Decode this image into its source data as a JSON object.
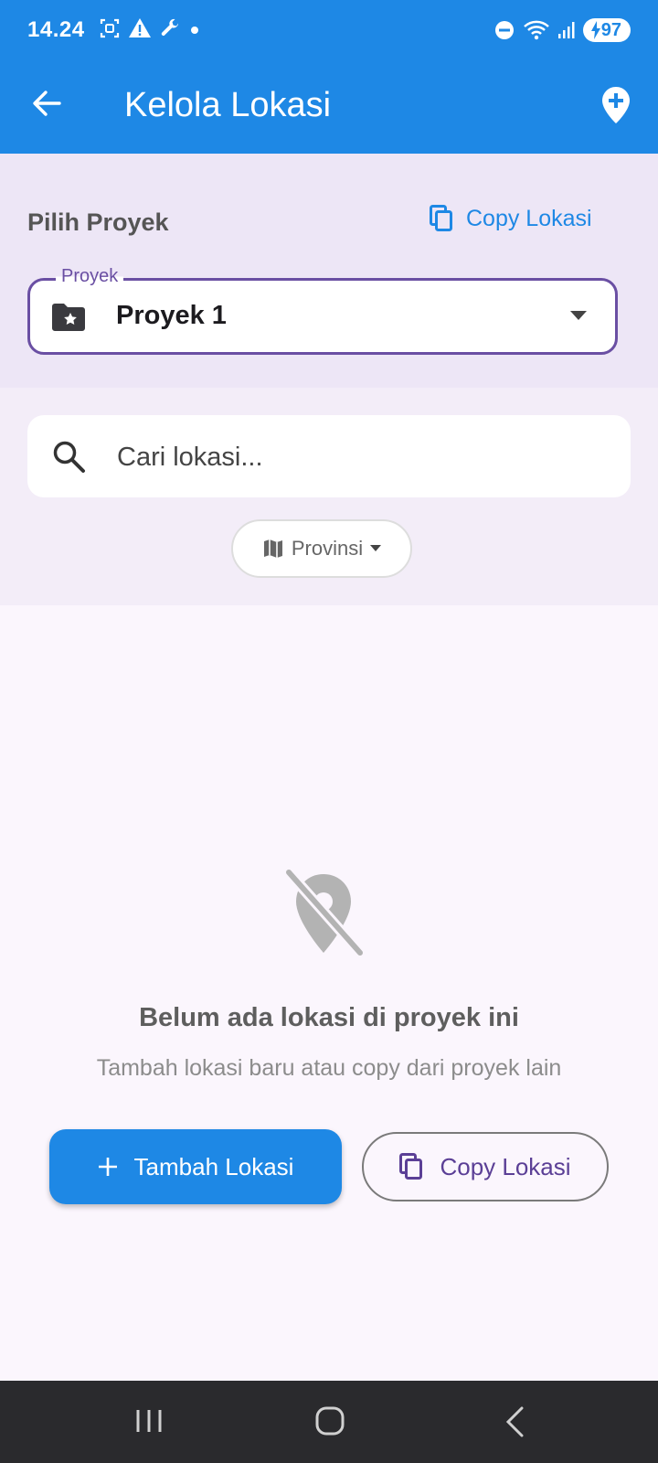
{
  "status": {
    "time": "14.24",
    "battery": "97"
  },
  "appbar": {
    "title": "Kelola Lokasi"
  },
  "project": {
    "section_label": "Pilih Proyek",
    "copy_label": "Copy Lokasi",
    "dropdown_legend": "Proyek",
    "selected": "Proyek 1"
  },
  "search": {
    "placeholder": "Cari lokasi..."
  },
  "filter": {
    "province_label": "Provinsi"
  },
  "empty": {
    "title": "Belum ada lokasi di proyek ini",
    "subtitle": "Tambah lokasi baru atau copy dari proyek lain",
    "add_button": "Tambah Lokasi",
    "copy_button": "Copy Lokasi"
  },
  "colors": {
    "primary": "#1e88e5",
    "accent": "#6a4fa3"
  }
}
